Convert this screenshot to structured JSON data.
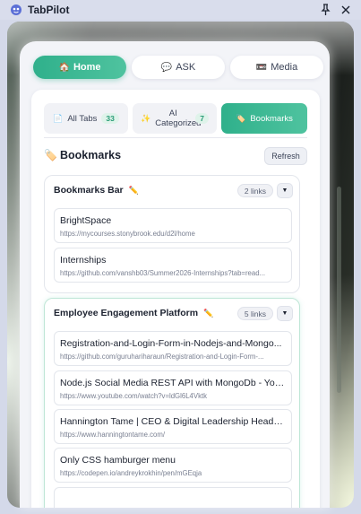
{
  "window": {
    "title": "TabPilot",
    "icons": [
      "app-icon",
      "pin-icon",
      "close-icon"
    ]
  },
  "nav": {
    "tabs": [
      {
        "icon": "🏠",
        "label": "Home",
        "active": true
      },
      {
        "icon": "💬",
        "label": "ASK",
        "active": false
      },
      {
        "icon": "📼",
        "label": "Media",
        "active": false
      }
    ]
  },
  "subtabs": [
    {
      "icon": "📄",
      "label": "All Tabs",
      "count": "33",
      "active": false
    },
    {
      "icon": "✨",
      "label": "AI Categorized",
      "count": "7",
      "active": false
    },
    {
      "icon": "🏷️",
      "label": "Bookmarks",
      "count": "",
      "active": true
    }
  ],
  "section": {
    "icon": "🏷️",
    "title": "Bookmarks",
    "refresh_label": "Refresh"
  },
  "groups": [
    {
      "title": "Bookmarks Bar",
      "count_label": "2 links",
      "links": [
        {
          "title": "BrightSpace",
          "url": "https://mycourses.stonybrook.edu/d2l/home"
        },
        {
          "title": "Internships",
          "url": "https://github.com/vanshb03/Summer2026-Internships?tab=read..."
        }
      ]
    },
    {
      "title": "Employee Engagement Platform",
      "count_label": "5 links",
      "links": [
        {
          "title": "Registration-and-Login-Form-in-Nodejs-and-Mongo...",
          "url": "https://github.com/guruhariharaun/Registration-and-Login-Form-..."
        },
        {
          "title": "Node.js Social Media REST API with MongoDb - YouT...",
          "url": "https://www.youtube.com/watch?v=ldGl6L4Vktk"
        },
        {
          "title": "Hannington Tame | CEO & Digital Leadership Headhu...",
          "url": "https://www.hanningtontame.com/"
        },
        {
          "title": "Only CSS hamburger menu",
          "url": "https://codepen.io/andreykrokhin/pen/mGEqja"
        }
      ]
    }
  ],
  "colors": {
    "accent": "#2fb08b",
    "accent_light": "#4fc39f",
    "badge_bg": "#dff3ea",
    "text": "#1c2230"
  }
}
